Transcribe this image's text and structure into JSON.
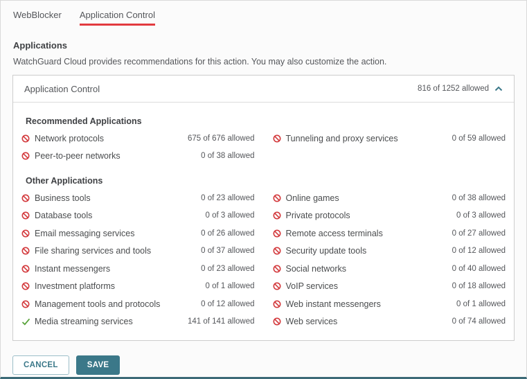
{
  "tabs": [
    {
      "label": "WebBlocker",
      "active": false
    },
    {
      "label": "Application Control",
      "active": true
    }
  ],
  "page": {
    "heading": "Applications",
    "description": "WatchGuard Cloud provides recommendations for this action. You may also customize the action."
  },
  "panel": {
    "title": "Application Control",
    "summary": "816 of 1252 allowed",
    "collapse_icon": "chevron-up-icon",
    "sections": [
      {
        "title": "Recommended Applications",
        "items": [
          {
            "label": "Network protocols",
            "count": "675 of 676 allowed",
            "status": "blocked"
          },
          {
            "label": "Tunneling and proxy services",
            "count": "0 of 59 allowed",
            "status": "blocked"
          },
          {
            "label": "Peer-to-peer networks",
            "count": "0 of 38 allowed",
            "status": "blocked"
          }
        ]
      },
      {
        "title": "Other Applications",
        "items": [
          {
            "label": "Business tools",
            "count": "0 of 23 allowed",
            "status": "blocked"
          },
          {
            "label": "Online games",
            "count": "0 of 38 allowed",
            "status": "blocked"
          },
          {
            "label": "Database tools",
            "count": "0 of 3 allowed",
            "status": "blocked"
          },
          {
            "label": "Private protocols",
            "count": "0 of 3 allowed",
            "status": "blocked"
          },
          {
            "label": "Email messaging services",
            "count": "0 of 26 allowed",
            "status": "blocked"
          },
          {
            "label": "Remote access terminals",
            "count": "0 of 27 allowed",
            "status": "blocked"
          },
          {
            "label": "File sharing services and tools",
            "count": "0 of 37 allowed",
            "status": "blocked"
          },
          {
            "label": "Security update tools",
            "count": "0 of 12 allowed",
            "status": "blocked"
          },
          {
            "label": "Instant messengers",
            "count": "0 of 23 allowed",
            "status": "blocked"
          },
          {
            "label": "Social networks",
            "count": "0 of 40 allowed",
            "status": "blocked"
          },
          {
            "label": "Investment platforms",
            "count": "0 of 1 allowed",
            "status": "blocked"
          },
          {
            "label": "VoIP services",
            "count": "0 of 18 allowed",
            "status": "blocked"
          },
          {
            "label": "Management tools and protocols",
            "count": "0 of 12 allowed",
            "status": "blocked"
          },
          {
            "label": "Web instant messengers",
            "count": "0 of 1 allowed",
            "status": "blocked"
          },
          {
            "label": "Media streaming services",
            "count": "141 of 141 allowed",
            "status": "allowed"
          },
          {
            "label": "Web services",
            "count": "0 of 74 allowed",
            "status": "blocked"
          }
        ]
      }
    ]
  },
  "footer": {
    "cancel_label": "CANCEL",
    "save_label": "SAVE"
  },
  "colors": {
    "accent_teal": "#3b7889",
    "blocked_red": "#d3393c",
    "allowed_green": "#58a33a",
    "tab_underline_red": "#e23a3f"
  }
}
